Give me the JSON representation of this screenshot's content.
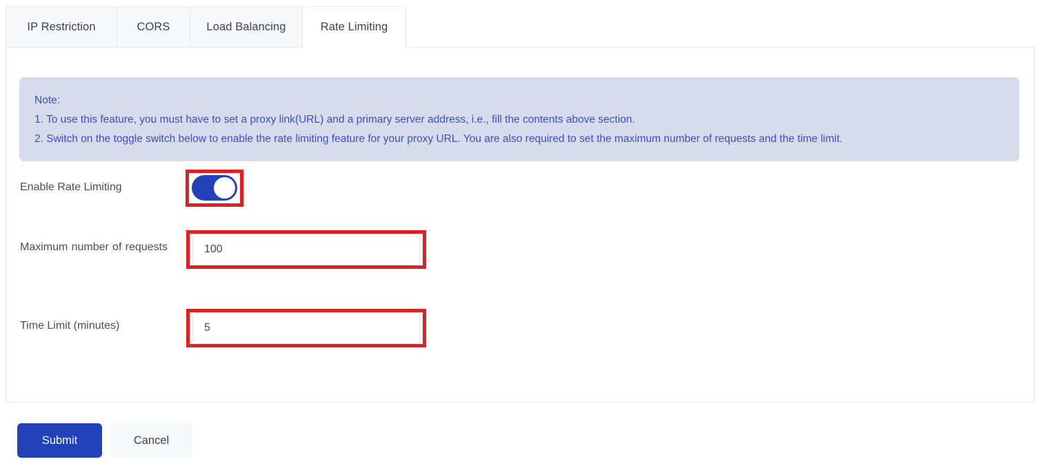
{
  "tabs": [
    {
      "id": "ip-restriction",
      "label": "IP Restriction",
      "active": false
    },
    {
      "id": "cors",
      "label": "CORS",
      "active": false
    },
    {
      "id": "load-balancing",
      "label": "Load Balancing",
      "active": false
    },
    {
      "id": "rate-limiting",
      "label": "Rate Limiting",
      "active": true
    }
  ],
  "note": {
    "heading": "Note:",
    "line1": "1. To use this feature, you must have to set a proxy link(URL) and a primary server address, i.e., fill the contents above section.",
    "line2": "2. Switch on the toggle switch below to enable the rate limiting feature for your proxy URL. You are also required to set the maximum number of requests and the time limit."
  },
  "form": {
    "enable_label": "Enable Rate Limiting",
    "enable_value": "on",
    "max_requests_label": "Maximum number of requests",
    "max_requests_value": "100",
    "max_requests_placeholder": "",
    "time_limit_label": "Time Limit (minutes)",
    "time_limit_value": "5",
    "time_limit_placeholder": ""
  },
  "actions": {
    "submit_label": "Submit",
    "cancel_label": "Cancel"
  },
  "colors": {
    "accent": "#2341b8",
    "note_bg": "#d6dcec",
    "note_text": "#3c4fc4",
    "highlight": "#e02020",
    "tab_inactive_bg": "#f7f8fa",
    "border": "#e6e8ec"
  }
}
